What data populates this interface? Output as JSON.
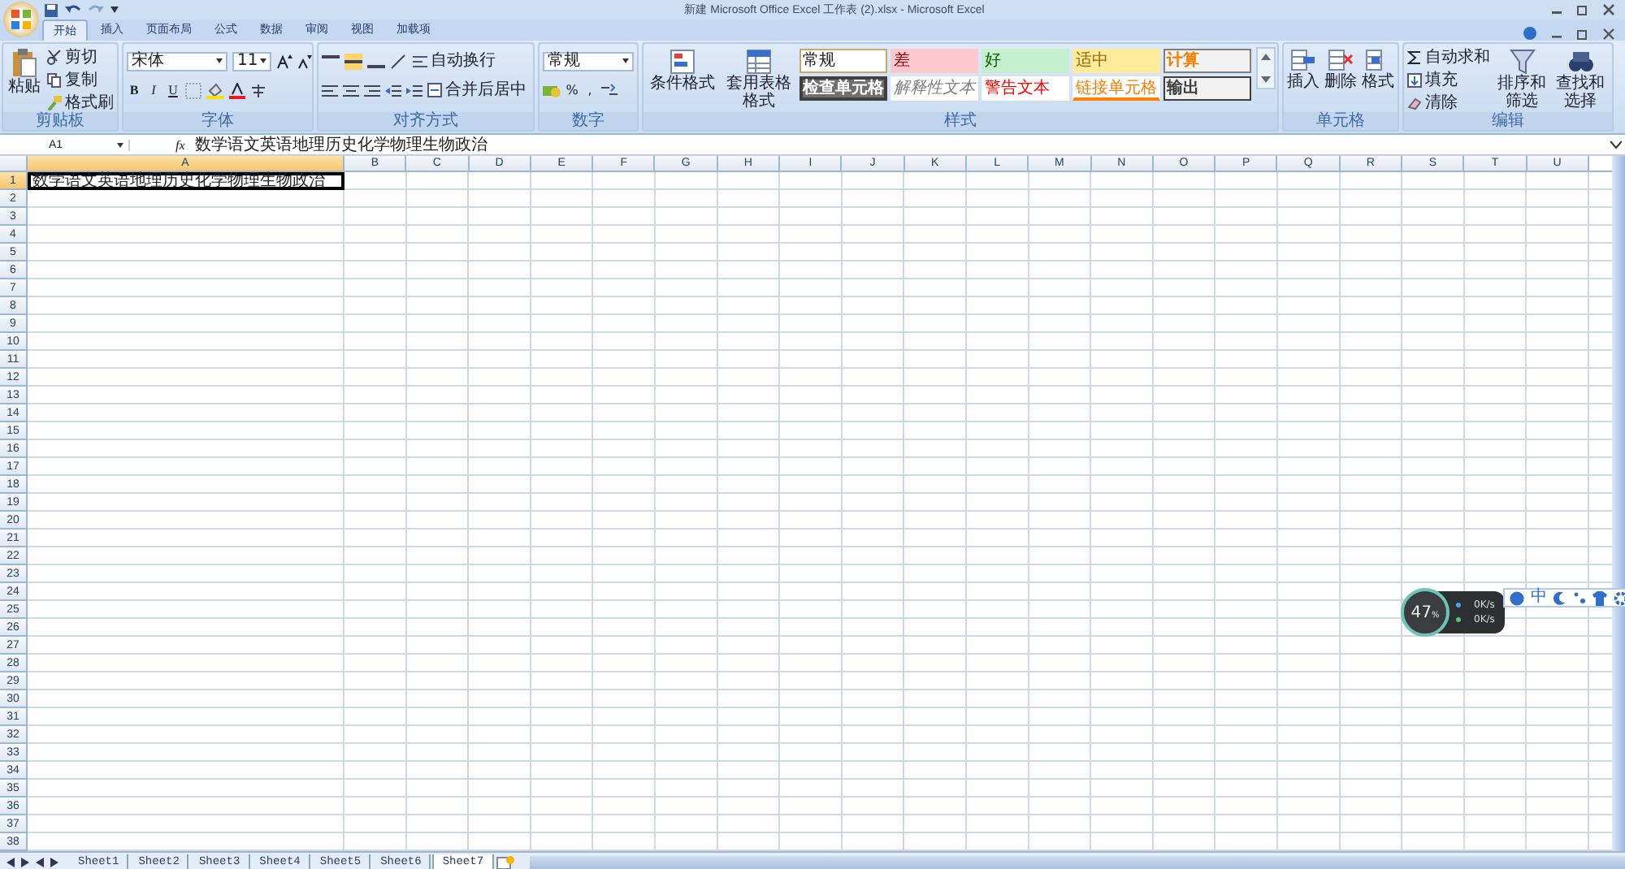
{
  "window": {
    "title": "新建 Microsoft Office Excel 工作表 (2).xlsx - Microsoft Excel"
  },
  "tabs": [
    {
      "label": "开始",
      "selected": true
    },
    {
      "label": "插入",
      "selected": false
    },
    {
      "label": "页面布局",
      "selected": false
    },
    {
      "label": "公式",
      "selected": false
    },
    {
      "label": "数据",
      "selected": false
    },
    {
      "label": "审阅",
      "selected": false
    },
    {
      "label": "视图",
      "selected": false
    },
    {
      "label": "加载项",
      "selected": false
    }
  ],
  "ribbon": {
    "groups": [
      {
        "kind": "clipboard",
        "label": "剪贴板",
        "big": "粘贴",
        "items": [
          "剪切",
          "复制",
          "格式刷"
        ]
      },
      {
        "kind": "font",
        "label": "字体",
        "font": "宋体",
        "size": "11",
        "format_buttons": [
          "B",
          "I",
          "U"
        ]
      },
      {
        "kind": "align",
        "label": "对齐方式",
        "items": [
          "自动换行",
          "合并后居中"
        ]
      },
      {
        "kind": "number",
        "label": "数字",
        "format": "常规",
        "symbols": [
          "%",
          ","
        ]
      },
      {
        "kind": "styles",
        "label": "样式",
        "big": [
          "条件格式",
          "套用表格格式"
        ],
        "cell_styles": [
          {
            "label": "常规",
            "kind": "normal"
          },
          {
            "label": "差",
            "kind": "bad"
          },
          {
            "label": "好",
            "kind": "good"
          },
          {
            "label": "适中",
            "kind": "neutral"
          },
          {
            "label": "计算",
            "kind": "calc"
          },
          {
            "label": "检查单元格",
            "kind": "check"
          },
          {
            "label": "解释性文本",
            "kind": "explanatory"
          },
          {
            "label": "警告文本",
            "kind": "warning"
          },
          {
            "label": "链接单元格",
            "kind": "linked"
          },
          {
            "label": "输出",
            "kind": "output"
          }
        ]
      },
      {
        "kind": "cells",
        "label": "单元格",
        "big": [
          "插入",
          "删除",
          "格式"
        ]
      },
      {
        "kind": "editing",
        "label": "编辑",
        "items": [
          "自动求和",
          "填充",
          "清除"
        ],
        "big": [
          "排序和筛选",
          "查找和选择"
        ]
      }
    ]
  },
  "formula_bar": {
    "name_box": "A1",
    "function_button": "fx",
    "formula": "数学语文英语地理历史化学物理生物政治"
  },
  "sheet": {
    "columns": [
      {
        "label": "A",
        "selected": true
      },
      {
        "label": "B",
        "selected": false
      },
      {
        "label": "C",
        "selected": false
      },
      {
        "label": "D",
        "selected": false
      },
      {
        "label": "E",
        "selected": false
      },
      {
        "label": "F",
        "selected": false
      },
      {
        "label": "G",
        "selected": false
      },
      {
        "label": "H",
        "selected": false
      },
      {
        "label": "I",
        "selected": false
      },
      {
        "label": "J",
        "selected": false
      },
      {
        "label": "K",
        "selected": false
      },
      {
        "label": "L",
        "selected": false
      },
      {
        "label": "M",
        "selected": false
      },
      {
        "label": "N",
        "selected": false
      },
      {
        "label": "O",
        "selected": false
      },
      {
        "label": "P",
        "selected": false
      },
      {
        "label": "Q",
        "selected": false
      },
      {
        "label": "R",
        "selected": false
      },
      {
        "label": "S",
        "selected": false
      },
      {
        "label": "T",
        "selected": false
      },
      {
        "label": "U",
        "selected": false
      }
    ],
    "rows": [
      {
        "label": "1",
        "selected": true,
        "cells": [
          "数学语文英语地理历史化学物理生物政治"
        ]
      },
      {
        "label": "2",
        "selected": false
      },
      {
        "label": "3",
        "selected": false
      },
      {
        "label": "4",
        "selected": false
      },
      {
        "label": "5",
        "selected": false
      },
      {
        "label": "6",
        "selected": false
      },
      {
        "label": "7",
        "selected": false
      },
      {
        "label": "8",
        "selected": false
      },
      {
        "label": "9",
        "selected": false
      },
      {
        "label": "10",
        "selected": false
      },
      {
        "label": "11",
        "selected": false
      },
      {
        "label": "12",
        "selected": false
      },
      {
        "label": "13",
        "selected": false
      },
      {
        "label": "14",
        "selected": false
      },
      {
        "label": "15",
        "selected": false
      },
      {
        "label": "16",
        "selected": false
      },
      {
        "label": "17",
        "selected": false
      },
      {
        "label": "18",
        "selected": false
      },
      {
        "label": "19",
        "selected": false
      },
      {
        "label": "20",
        "selected": false
      },
      {
        "label": "21",
        "selected": false
      },
      {
        "label": "22",
        "selected": false
      },
      {
        "label": "23",
        "selected": false
      },
      {
        "label": "24",
        "selected": false
      },
      {
        "label": "25",
        "selected": false
      },
      {
        "label": "26",
        "selected": false
      },
      {
        "label": "27",
        "selected": false
      },
      {
        "label": "28",
        "selected": false
      },
      {
        "label": "29",
        "selected": false
      },
      {
        "label": "30",
        "selected": false
      },
      {
        "label": "31",
        "selected": false
      },
      {
        "label": "32",
        "selected": false
      },
      {
        "label": "33",
        "selected": false
      },
      {
        "label": "34",
        "selected": false
      },
      {
        "label": "35",
        "selected": false
      },
      {
        "label": "36",
        "selected": false
      },
      {
        "label": "37",
        "selected": false
      },
      {
        "label": "38",
        "selected": false
      }
    ]
  },
  "sheet_tabs": [
    {
      "label": "Sheet1",
      "selected": false
    },
    {
      "label": "Sheet2",
      "selected": false
    },
    {
      "label": "Sheet3",
      "selected": false
    },
    {
      "label": "Sheet4",
      "selected": false
    },
    {
      "label": "Sheet5",
      "selected": false
    },
    {
      "label": "Sheet6",
      "selected": false
    },
    {
      "label": "Sheet7",
      "selected": true
    }
  ],
  "speed_widget": {
    "percent": "47",
    "unit": "%",
    "upload": "0K/s",
    "download": "0K/s"
  },
  "ime_toolbar": {
    "mode": "中"
  }
}
